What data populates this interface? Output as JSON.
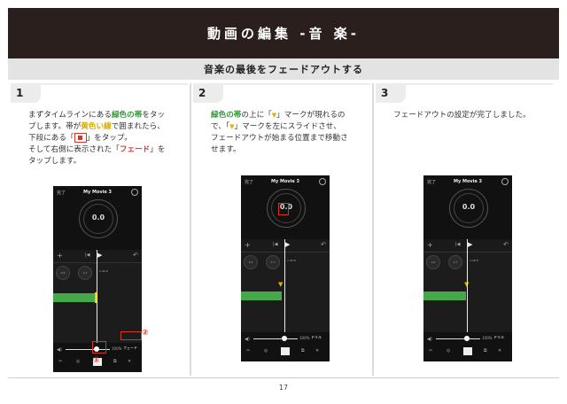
{
  "header": {
    "title": "動画の編集 -音 楽-"
  },
  "subheader": {
    "title": "音楽の最後をフェードアウトする"
  },
  "steps": [
    {
      "number": "1",
      "lines": [
        {
          "parts": [
            {
              "t": "まずタイムラインにある",
              "c": ""
            },
            {
              "t": "緑色の帯",
              "c": "green"
            },
            {
              "t": "をタッ",
              "c": ""
            }
          ]
        },
        {
          "parts": [
            {
              "t": "プします。帯が",
              "c": ""
            },
            {
              "t": "黄色い線",
              "c": "yellow"
            },
            {
              "t": "で囲まれたら、",
              "c": ""
            }
          ]
        },
        {
          "parts": [
            {
              "t": "下段にある「",
              "c": ""
            },
            {
              "t": "[chip]",
              "c": "chip"
            },
            {
              "t": "」をタップ。",
              "c": ""
            }
          ]
        },
        {
          "parts": [
            {
              "t": "そして右側に表示された「",
              "c": ""
            },
            {
              "t": "フェード",
              "c": "red"
            },
            {
              "t": "」を",
              "c": ""
            }
          ]
        },
        {
          "parts": [
            {
              "t": "タップします。",
              "c": ""
            }
          ]
        }
      ]
    },
    {
      "number": "2",
      "lines": [
        {
          "parts": [
            {
              "t": "緑色の帯",
              "c": "green"
            },
            {
              "t": "の上に「",
              "c": ""
            },
            {
              "t": "▼",
              "c": "tri"
            },
            {
              "t": "」マークが現れるの",
              "c": ""
            }
          ]
        },
        {
          "parts": [
            {
              "t": "で、「",
              "c": ""
            },
            {
              "t": "▼",
              "c": "tri"
            },
            {
              "t": "」マークを左にスライドさせ、",
              "c": ""
            }
          ]
        },
        {
          "parts": [
            {
              "t": "フェードアウトが始まる位置まで移動さ",
              "c": ""
            }
          ]
        },
        {
          "parts": [
            {
              "t": "せます。",
              "c": ""
            }
          ]
        }
      ]
    },
    {
      "number": "3",
      "lines": [
        {
          "parts": [
            {
              "t": "フェードアウトの設定が完了しました。",
              "c": ""
            }
          ]
        }
      ]
    }
  ],
  "phone": {
    "done": "完了",
    "title": "My Movie 3",
    "timecode": "1:46.8",
    "dial_value": "0.0",
    "clip_labels": [
      "2.6",
      "3.7",
      "1:46.8"
    ],
    "volume_pct": "100%",
    "fade_label": "フェード",
    "fade_label_short": "ドリル"
  },
  "callouts": {
    "one": "①",
    "two": "②"
  },
  "page": {
    "number": "17"
  }
}
